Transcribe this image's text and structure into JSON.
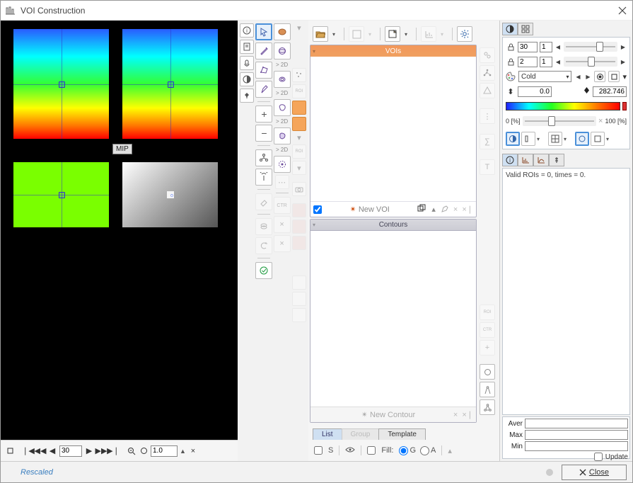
{
  "window": {
    "title": "VOI Construction"
  },
  "viewer": {
    "mipLabel": "MIP",
    "frame": "30",
    "zoom": "1.0"
  },
  "topbarVOIs": {
    "title": "VOIs",
    "newVOI": "New VOI"
  },
  "contoursPanel": {
    "title": "Contours",
    "newContour": "New Contour"
  },
  "tabs": {
    "list": "List",
    "group": "Group",
    "template": "Template"
  },
  "sToggle": "S",
  "fill": {
    "label": "Fill:",
    "optG": "G",
    "optA": "A"
  },
  "colorPanel": {
    "spin1": "30",
    "spin1b": "1",
    "spin2": "2",
    "spin2b": "1",
    "paletteName": "Cold",
    "minVal": "0.0",
    "maxVal": "282.746",
    "pctLow": "0  [%]",
    "pctHigh": "100  [%]"
  },
  "infoPanel": {
    "text": "Valid ROIs = 0, times = 0."
  },
  "stats": {
    "aver": "Aver",
    "max": "Max",
    "min": "Min",
    "update": "Update"
  },
  "footer": {
    "status": "Rescaled",
    "close": "Close"
  },
  "two_d": "> 2D",
  "modal": "×"
}
